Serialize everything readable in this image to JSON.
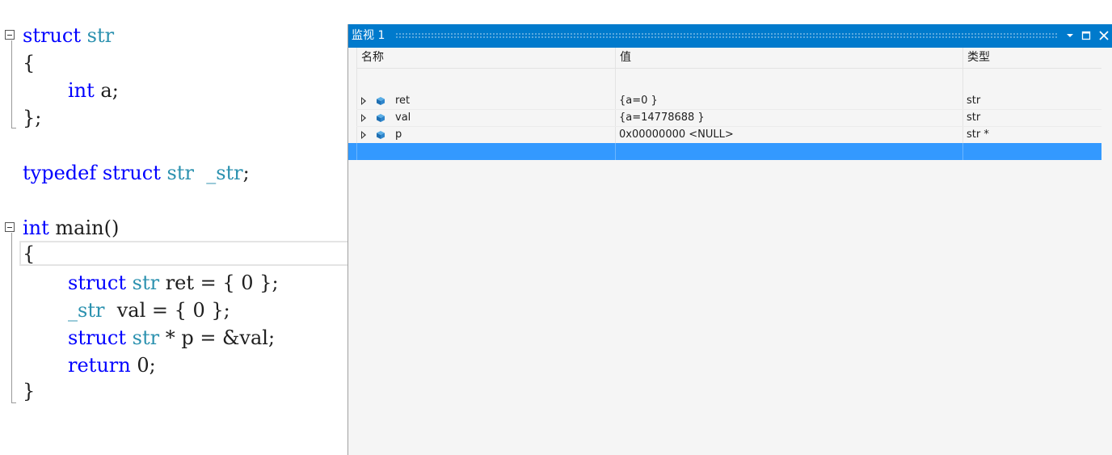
{
  "editor": {
    "lines": {
      "l1": {
        "kw1": "struct",
        "ty1": "str"
      },
      "l2": {
        "text": "{"
      },
      "l3": {
        "kw1": "int",
        "text": " a;"
      },
      "l4": {
        "text": "};"
      },
      "l5": {
        "kw1": "typedef",
        "kw2": "struct",
        "ty1": "str",
        "ty2": "_str",
        "text": ";"
      },
      "l6": {
        "kw1": "int",
        "text": " main()"
      },
      "l7": {
        "text": "{"
      },
      "l8": {
        "kw1": "struct",
        "ty1": "str",
        "text": " ret = { 0 };"
      },
      "l9": {
        "ty1": "_str",
        "text": "  val = { 0 };"
      },
      "l10": {
        "kw1": "struct",
        "ty1": "str",
        "text": " * p = &val;"
      },
      "l11": {
        "kw1": "return",
        "text": " 0;"
      },
      "l12": {
        "text": "}"
      }
    },
    "colors": {
      "keyword": "#0000ff",
      "type": "#2b91af",
      "text": "#1e1e1e"
    }
  },
  "watch": {
    "title": "监视 1",
    "buttons": {
      "dropdown": "▼",
      "maximize": "□",
      "close": "✕"
    },
    "columns": {
      "name": "名称",
      "value": "值",
      "type": "类型"
    },
    "rows": [
      {
        "name": "ret",
        "value": "{a=0 }",
        "type": "str"
      },
      {
        "name": "val",
        "value": "{a=14778688 }",
        "type": "str"
      },
      {
        "name": "p",
        "value": "0x00000000 <NULL>",
        "type": "str *"
      }
    ],
    "colors": {
      "titlebar": "#007acc",
      "selection": "#3399ff",
      "background": "#f5f5f5"
    },
    "icons": {
      "expand": "expand-arrow-icon",
      "variable": "variable-cube-icon"
    }
  }
}
